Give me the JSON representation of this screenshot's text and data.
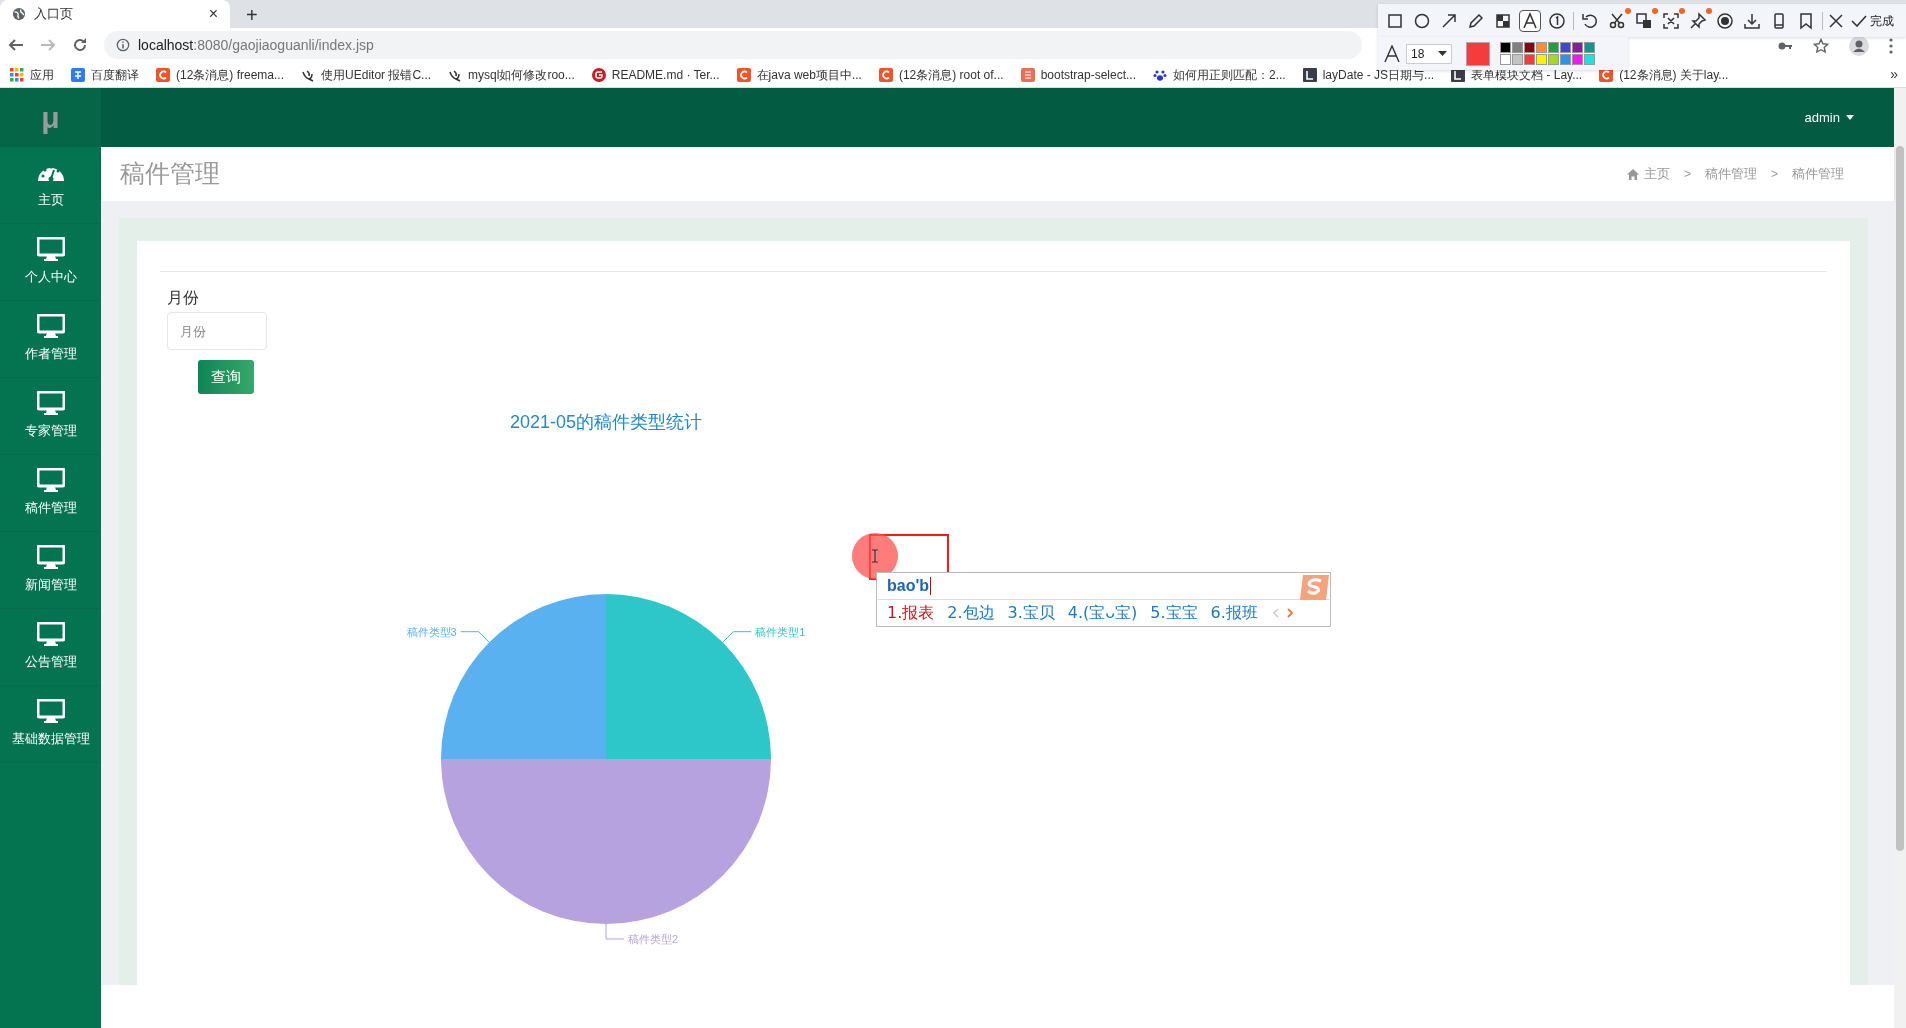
{
  "browser": {
    "tab": {
      "title": "入口页",
      "close": "×"
    },
    "new_tab": "+",
    "forward": {
      "disabled": true
    },
    "address": {
      "host": "localhost",
      "path": ":8080/gaojiaoguanli/index.jsp"
    },
    "bookmarks": [
      {
        "kind": "apps",
        "label": "应用"
      },
      {
        "kind": "translate",
        "label": "百度翻译"
      },
      {
        "kind": "csdn",
        "label": "(12条消息) freema..."
      },
      {
        "kind": "feather",
        "label": "使用UEditor 报错C..."
      },
      {
        "kind": "feather",
        "label": "mysql如何修改roo..."
      },
      {
        "kind": "gitee",
        "label": "README.md · Ter..."
      },
      {
        "kind": "csdn",
        "label": "在java web项目中..."
      },
      {
        "kind": "csdn",
        "label": "(12条消息) root of..."
      },
      {
        "kind": "jian",
        "label": "bootstrap-select..."
      },
      {
        "kind": "paw",
        "label": "如何用正则匹配：2..."
      },
      {
        "kind": "lay",
        "label": "layDate - JS日期与..."
      },
      {
        "kind": "lay",
        "label": "表单模块文档 - Lay..."
      },
      {
        "kind": "csdn",
        "label": "(12条消息) 关于lay..."
      }
    ],
    "more_bookmarks": "»"
  },
  "capture_toolbar": {
    "tools": [
      {
        "kind": "rect",
        "selected": false,
        "badge": false
      },
      {
        "kind": "circle",
        "selected": false,
        "badge": false
      },
      {
        "kind": "arrow",
        "selected": false,
        "badge": false
      },
      {
        "kind": "pencil",
        "selected": false,
        "badge": false
      },
      {
        "kind": "mosaic",
        "selected": false,
        "badge": false
      },
      {
        "kind": "text",
        "selected": true,
        "badge": false
      },
      {
        "kind": "number",
        "selected": false,
        "badge": false
      },
      {
        "kind": "undo",
        "selected": false,
        "badge": false
      },
      {
        "kind": "scissors",
        "selected": false,
        "badge": true
      },
      {
        "kind": "translate",
        "selected": false,
        "badge": true
      },
      {
        "kind": "ocr",
        "selected": false,
        "badge": true
      },
      {
        "kind": "pin",
        "selected": false,
        "badge": true
      },
      {
        "kind": "record",
        "selected": false,
        "badge": false
      },
      {
        "kind": "download",
        "selected": false,
        "badge": false
      },
      {
        "kind": "phone",
        "selected": false,
        "badge": false
      },
      {
        "kind": "bookmark",
        "selected": false,
        "badge": false
      }
    ],
    "done": "完成",
    "font_size": "18",
    "current": {
      "color": "#f53b3b"
    },
    "palette": [
      {
        "color": "#000000"
      },
      {
        "color": "#7f7f7f"
      },
      {
        "color": "#880015"
      },
      {
        "color": "#ff8c37"
      },
      {
        "color": "#22a03c"
      },
      {
        "color": "#3f48cc"
      },
      {
        "color": "#8b1a9f"
      },
      {
        "color": "#13968f"
      },
      {
        "color": "#ffffff"
      },
      {
        "color": "#c3c3c3"
      },
      {
        "color": "#f53b3b"
      },
      {
        "color": "#fff200"
      },
      {
        "color": "#a6d81e"
      },
      {
        "color": "#2e92e6"
      },
      {
        "color": "#f516f5"
      },
      {
        "color": "#1ee0e0"
      }
    ]
  },
  "app": {
    "logo": "μ",
    "user": "admin",
    "sidebar": [
      {
        "kind": "dashboard",
        "label": "主页"
      },
      {
        "kind": "monitor",
        "label": "个人中心"
      },
      {
        "kind": "monitor",
        "label": "作者管理"
      },
      {
        "kind": "monitor",
        "label": "专家管理"
      },
      {
        "kind": "monitor",
        "label": "稿件管理"
      },
      {
        "kind": "monitor",
        "label": "新闻管理"
      },
      {
        "kind": "monitor",
        "label": "公告管理"
      },
      {
        "kind": "monitor",
        "label": "基础数据管理"
      }
    ],
    "page_title": "稿件管理",
    "breadcrumb": {
      "items": [
        "主页",
        "稿件管理",
        "稿件管理"
      ],
      "separators": [
        ">",
        ">"
      ]
    },
    "form": {
      "label": "月份",
      "placeholder": "月份",
      "button": "查询"
    },
    "chart_data": {
      "type": "pie",
      "title": "2021-05的稿件类型统计",
      "categories": [
        "稿件类型1",
        "稿件类型2",
        "稿件类型3"
      ],
      "values": [
        1,
        2,
        1
      ]
    }
  },
  "ime": {
    "input": "bao'b",
    "candidates": [
      {
        "label": "1.报表",
        "selected": true
      },
      {
        "label": "2.包边",
        "selected": false
      },
      {
        "label": "3.宝贝",
        "selected": false
      },
      {
        "label": "4.(宝ᴗ宝)",
        "selected": false
      },
      {
        "label": "5.宝宝",
        "selected": false
      },
      {
        "label": "6.报班",
        "selected": false
      }
    ],
    "prev": {
      "disabled": true
    }
  }
}
